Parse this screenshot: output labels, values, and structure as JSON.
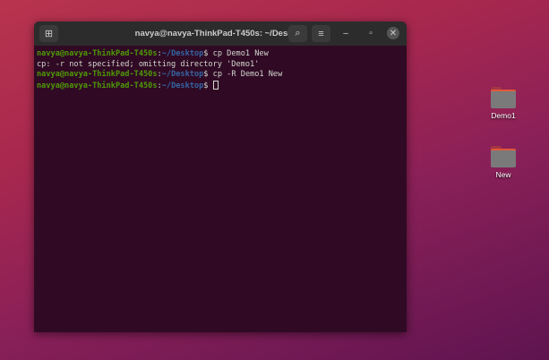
{
  "window": {
    "title": "navya@navya-ThinkPad-T450s: ~/Desktop"
  },
  "terminal": {
    "lines": [
      {
        "user": "navya@navya-ThinkPad-T450s",
        "path": "~/Desktop",
        "cmd": " cp Demo1 New"
      },
      {
        "output": "cp: -r not specified; omitting directory 'Demo1'"
      },
      {
        "user": "navya@navya-ThinkPad-T450s",
        "path": "~/Desktop",
        "cmd": " cp -R Demo1 New"
      },
      {
        "user": "navya@navya-ThinkPad-T450s",
        "path": "~/Desktop",
        "cmd": " "
      }
    ],
    "colon": ":",
    "dollar": "$"
  },
  "desktop": {
    "icons": [
      {
        "label": "Demo1"
      },
      {
        "label": "New"
      }
    ]
  }
}
